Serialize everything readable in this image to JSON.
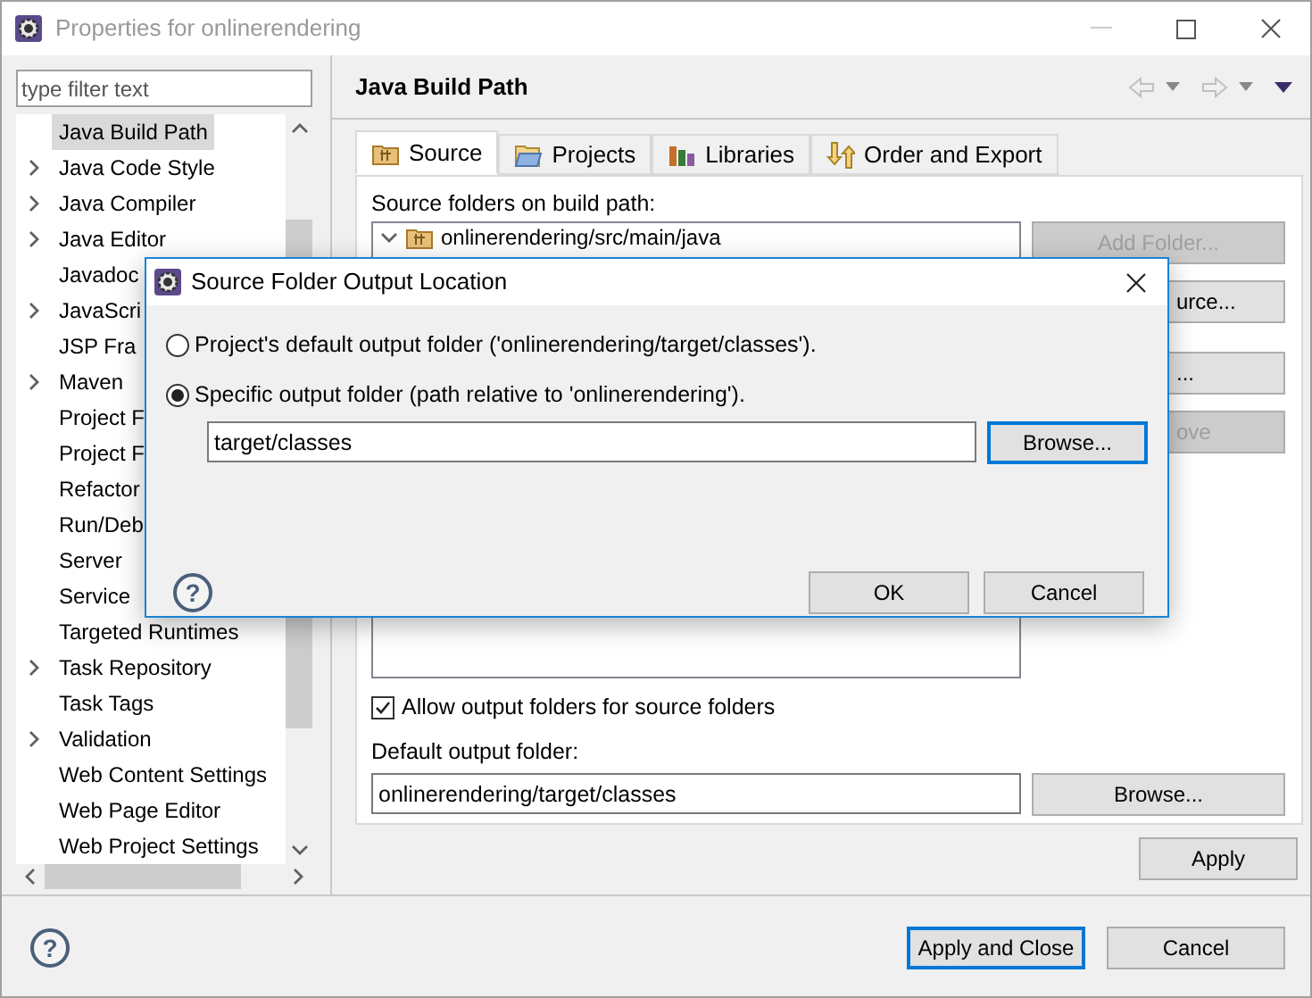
{
  "window": {
    "title": "Properties for onlinerendering",
    "active": false
  },
  "filter": {
    "placeholder": "type filter text"
  },
  "sidebar": {
    "items": [
      {
        "label": "Java Build Path",
        "expandable": false,
        "selected": true
      },
      {
        "label": "Java Code Style",
        "expandable": true,
        "selected": false
      },
      {
        "label": "Java Compiler",
        "expandable": true,
        "selected": false
      },
      {
        "label": "Java Editor",
        "expandable": true,
        "selected": false
      },
      {
        "label": "Javadoc",
        "expandable": false,
        "selected": false
      },
      {
        "label": "JavaScri",
        "expandable": true,
        "selected": false
      },
      {
        "label": "JSP Fra",
        "expandable": false,
        "selected": false
      },
      {
        "label": "Maven",
        "expandable": true,
        "selected": false
      },
      {
        "label": "Project F",
        "expandable": false,
        "selected": false
      },
      {
        "label": "Project F",
        "expandable": false,
        "selected": false
      },
      {
        "label": "Refactor",
        "expandable": false,
        "selected": false
      },
      {
        "label": "Run/Deb",
        "expandable": false,
        "selected": false
      },
      {
        "label": "Server",
        "expandable": false,
        "selected": false
      },
      {
        "label": "Service",
        "expandable": false,
        "selected": false
      },
      {
        "label": "Targeted Runtimes",
        "expandable": false,
        "selected": false
      },
      {
        "label": "Task Repository",
        "expandable": true,
        "selected": false
      },
      {
        "label": "Task Tags",
        "expandable": false,
        "selected": false
      },
      {
        "label": "Validation",
        "expandable": true,
        "selected": false
      },
      {
        "label": "Web Content Settings",
        "expandable": false,
        "selected": false
      },
      {
        "label": "Web Page Editor",
        "expandable": false,
        "selected": false
      },
      {
        "label": "Web Project Settings",
        "expandable": false,
        "selected": false
      }
    ]
  },
  "page": {
    "title": "Java Build Path",
    "tabs": [
      {
        "label": "Source",
        "kind": "source",
        "selected": true
      },
      {
        "label": "Projects",
        "kind": "projects",
        "selected": false
      },
      {
        "label": "Libraries",
        "kind": "libraries",
        "selected": false
      },
      {
        "label": "Order and Export",
        "kind": "order",
        "selected": false
      }
    ],
    "source_label": "Source folders on build path:",
    "source_tree": [
      {
        "label": "onlinerendering/src/main/java",
        "expanded": true
      }
    ],
    "side_buttons": [
      {
        "label": "Add Folder...",
        "disabled": true
      },
      {
        "label": "urce...",
        "disabled": false
      },
      {
        "label": "...",
        "disabled": false
      },
      {
        "label": "ove",
        "disabled": true
      }
    ],
    "allow_output": {
      "label": "Allow output folders for source folders",
      "checked": true
    },
    "output_label": "Default output folder:",
    "output_value": "onlinerendering/target/classes",
    "browse": "Browse...",
    "apply": "Apply"
  },
  "help_glyph": "?",
  "footer": {
    "buttons": [
      {
        "label": "Apply and Close",
        "focused": true
      },
      {
        "label": "Cancel",
        "focused": false
      }
    ]
  },
  "dialog": {
    "title": "Source Folder Output Location",
    "options": [
      {
        "label": "Project's default output folder ('onlinerendering/target/classes').",
        "selected": false
      },
      {
        "label": "Specific output folder (path relative to 'onlinerendering').",
        "selected": true
      }
    ],
    "path": "target/classes",
    "browse": {
      "label": "Browse...",
      "focused": true
    },
    "buttons": [
      {
        "label": "OK",
        "focused": false
      },
      {
        "label": "Cancel",
        "focused": false
      }
    ]
  }
}
